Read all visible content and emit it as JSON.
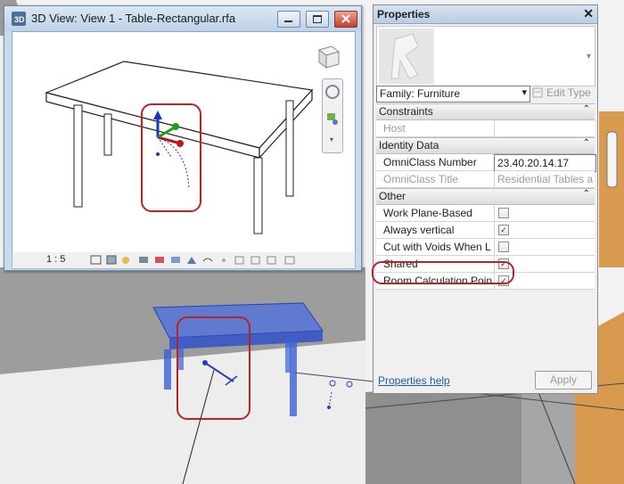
{
  "view_window": {
    "title": "3D View: View 1 - Table-Rectangular.rfa",
    "scale": "1 : 5"
  },
  "properties": {
    "title": "Properties",
    "close_glyph": "✕",
    "family_selector": "Family: Furniture",
    "edit_type_label": "Edit Type",
    "sections": [
      {
        "name": "Constraints",
        "rows": [
          {
            "label": "Host",
            "value": "",
            "disabled": true
          }
        ]
      },
      {
        "name": "Identity Data",
        "rows": [
          {
            "label": "OmniClass Number",
            "value": "23.40.20.14.17",
            "disabled": false
          },
          {
            "label": "OmniClass Title",
            "value": "Residential Tables a...",
            "disabled": true
          }
        ]
      },
      {
        "name": "Other",
        "rows": [
          {
            "label": "Work Plane-Based",
            "checked": false
          },
          {
            "label": "Always vertical",
            "checked": true
          },
          {
            "label": "Cut with Voids When L...",
            "checked": false
          },
          {
            "label": "Shared",
            "checked": true
          },
          {
            "label": "Room Calculation Point",
            "checked": true
          }
        ]
      }
    ],
    "help_link": "Properties help",
    "apply_label": "Apply"
  },
  "icons": {
    "collapse": "chevron-up-icon",
    "checkmark": "checkmark-icon"
  },
  "colors": {
    "highlight_red": "#b82323",
    "table_selection_blue": "#3b5fd6",
    "wall_orange": "#d79a4e"
  }
}
